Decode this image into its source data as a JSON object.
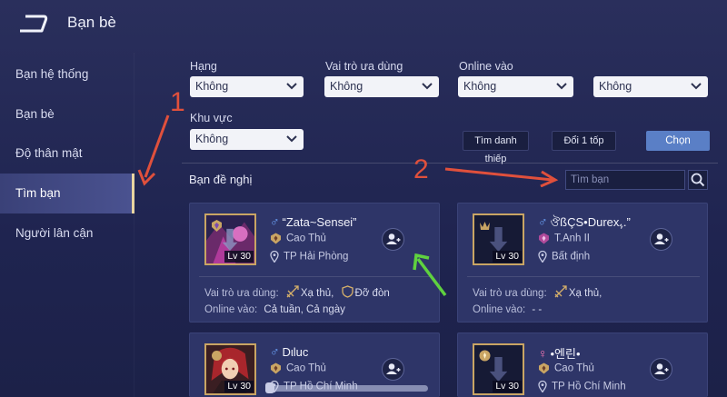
{
  "header": {
    "title": "Bạn bè"
  },
  "sidebar": {
    "items": [
      {
        "label": "Bạn hệ thống"
      },
      {
        "label": "Bạn bè"
      },
      {
        "label": "Độ thân mật"
      },
      {
        "label": "Tìm bạn",
        "active": true
      },
      {
        "label": "Người lân cận"
      }
    ]
  },
  "filters": {
    "rank_label": "Hạng",
    "rank_value": "Không",
    "role_label": "Vai trò ưa dùng",
    "role_value": "Không",
    "online_label": "Online vào",
    "online_value": "Không",
    "online_value2": "Không",
    "region_label": "Khu vực",
    "region_value": "Không",
    "btn_find_card": "Tìm danh thiếp",
    "btn_change_team": "Đổi 1 tốp",
    "btn_choose": "Chọn"
  },
  "suggest": {
    "title": "Bạn đề nghị",
    "search_placeholder": "Tìm bạn"
  },
  "cards": [
    {
      "name": "“Zata~Sensei”",
      "gender": "male",
      "gender_symbol": "♂",
      "rank": "Cao Thủ",
      "location": "TP Hải Phòng",
      "level": "Lv 30",
      "roles_label": "Vai trò ưa dùng:",
      "roles": [
        "Xạ thủ,",
        "Đỡ đòn"
      ],
      "online_label": "Online vào:",
      "online": "Cả tuần, Cả ngày"
    },
    {
      "name": "ঔßÇS•Durexﮩ.”",
      "gender": "male",
      "gender_symbol": "♂",
      "rank": "T.Anh II",
      "location": "Bất định",
      "level": "Lv 30",
      "roles_label": "Vai trò ưa dùng:",
      "roles": [
        "Xạ thủ,"
      ],
      "online_label": "Online vào:",
      "online": "- -"
    },
    {
      "name": "Dιluc",
      "gender": "male",
      "gender_symbol": "♂",
      "rank": "Cao Thủ",
      "location": "TP Hồ Chí Minh",
      "level": "Lv 30"
    },
    {
      "name": "•엔린•",
      "gender": "female",
      "gender_symbol": "♀",
      "rank": "Cao Thủ",
      "location": "TP Hồ Chí Minh",
      "level": "Lv 30"
    }
  ],
  "annotations": {
    "label_1": "1",
    "label_2": "2"
  },
  "colors": {
    "accent_blue": "#5a7fc6",
    "annotation_red": "#e0503c",
    "annotation_green": "#5fd13f",
    "gold": "#c9a564"
  }
}
